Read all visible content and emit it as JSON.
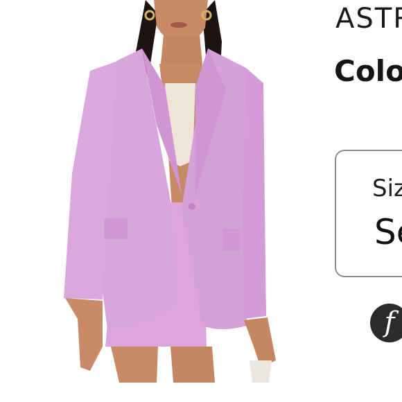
{
  "product": {
    "brand": "ASTR",
    "color_label": "Colo"
  },
  "size_selector": {
    "label": "Siz",
    "value": "Se"
  },
  "logo": {
    "glyph": "f",
    "icon": "f-logo-icon"
  },
  "colors": {
    "blazer": "#d9a3dc",
    "skirt": "#dca4dc",
    "top": "#efe4d8",
    "border": "#8c8c8c",
    "logo_bg": "#2b2b2b"
  }
}
